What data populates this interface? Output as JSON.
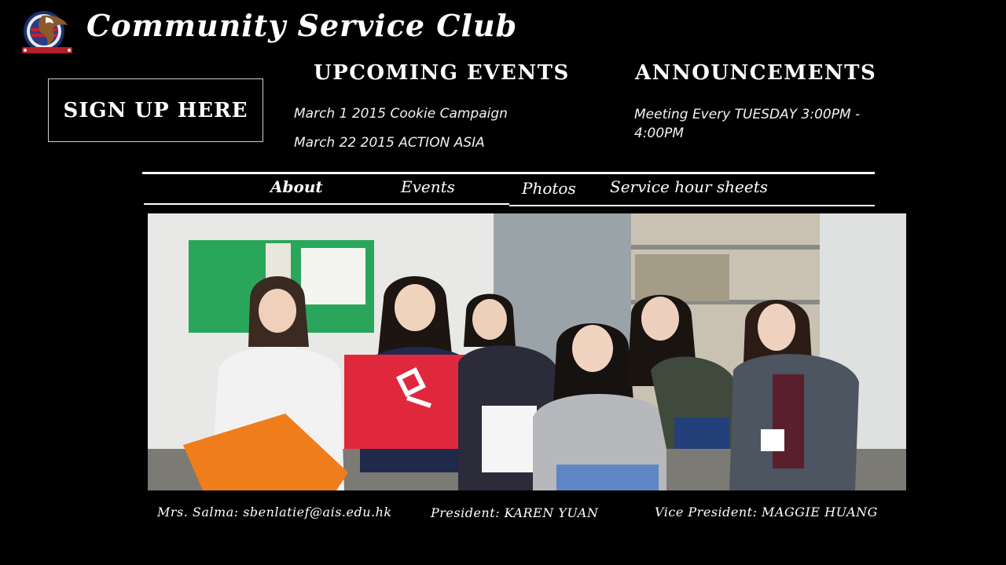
{
  "header": {
    "title": "Community Service Club",
    "logo_icon": "club-crest-eagle-icon"
  },
  "signup": {
    "label": "SIGN UP HERE"
  },
  "events": {
    "heading": "UPCOMING EVENTS",
    "items": [
      "March 1 2015 Cookie Campaign",
      "March 22 2015 ACTION ASIA"
    ]
  },
  "announcements": {
    "heading": "ANNOUNCEMENTS",
    "items": [
      "Meeting Every TUESDAY 3:00PM - 4:00PM"
    ]
  },
  "nav": {
    "items": [
      {
        "label": "About"
      },
      {
        "label": "Events"
      },
      {
        "label": "Photos"
      },
      {
        "label": "Service hour sheets"
      }
    ]
  },
  "photo": {
    "subject": "group-photo"
  },
  "footer": {
    "advisor": "Mrs. Salma: sbenlatief@ais.edu.hk",
    "president": "President: KAREN YUAN",
    "vice_president": "Vice President: MAGGIE HUANG"
  },
  "colors": {
    "background": "#000000",
    "text": "#ffffff"
  }
}
